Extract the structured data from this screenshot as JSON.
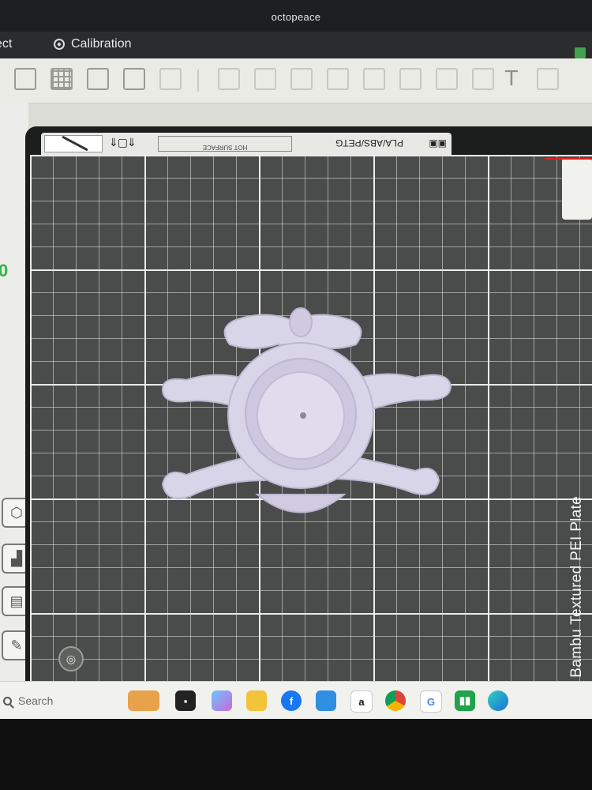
{
  "window": {
    "title": "octopeace"
  },
  "menu": {
    "project_label": "ect",
    "calibration_label": "Calibration"
  },
  "toolbar": {
    "buttons": [
      "add-object-icon",
      "grid-plate-icon",
      "auto-orient-icon",
      "arrange-icon",
      "list-icon",
      "move-icon",
      "rotate-icon",
      "scale-icon",
      "cut-icon",
      "support-icon",
      "seam-icon",
      "mesh-boolean-icon",
      "paint-icon",
      "text-tool-icon",
      "measure-icon"
    ]
  },
  "left_panel": {
    "indicator_text": "0"
  },
  "plate_bar": {
    "hot_surface_text": "HOT SURFACE",
    "material_text": "PLA/ABS/PETG"
  },
  "plate": {
    "name": "Bambu Textured PEI Plate"
  },
  "taskbar": {
    "search_placeholder": "Search",
    "apps": [
      "cat-widget-icon",
      "terminal-icon",
      "copilot-icon",
      "file-explorer-icon",
      "facebook-icon",
      "photos-icon",
      "amazon-icon",
      "chrome-icon",
      "google-icon",
      "bambu-studio-icon",
      "edge-icon"
    ],
    "amazon_glyph": "a"
  },
  "colors": {
    "model": "#d8d4e6",
    "plate": "#4a4c4b",
    "accent_green": "#33b24a"
  }
}
